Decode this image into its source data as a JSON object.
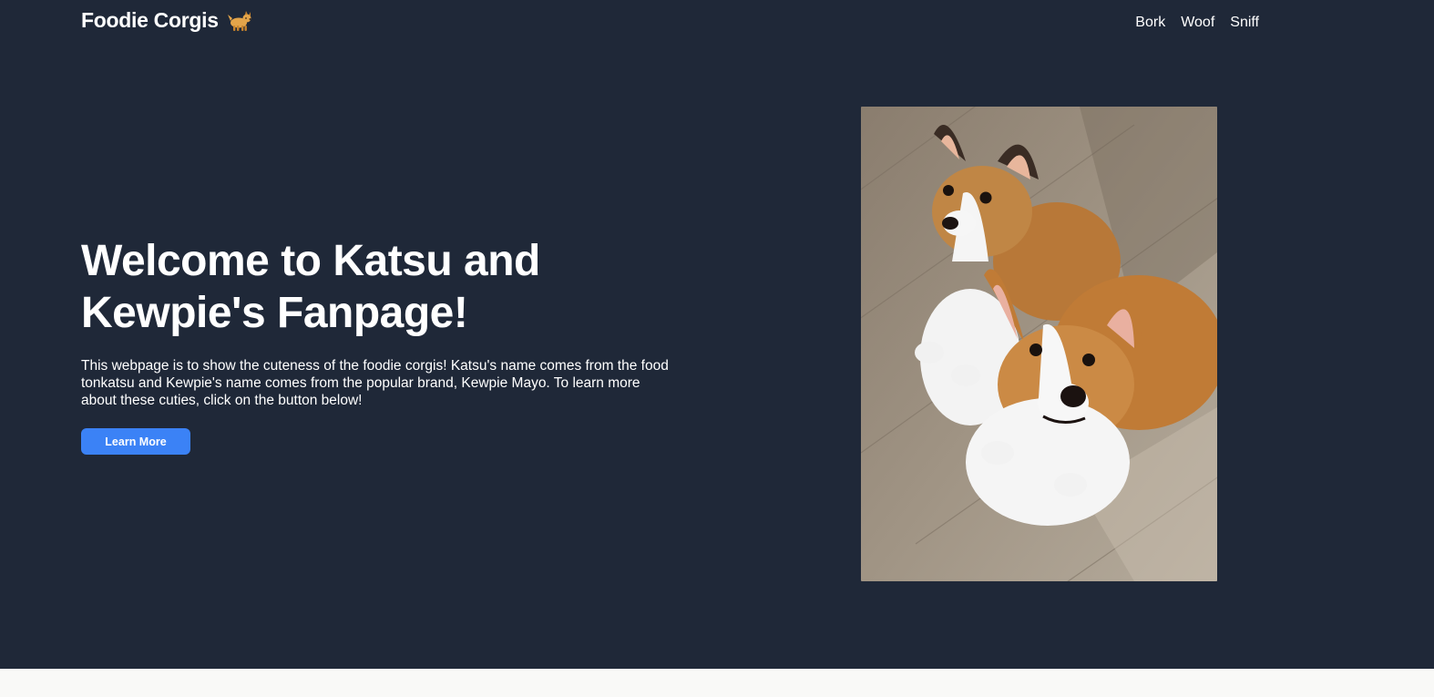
{
  "nav": {
    "brand": "Foodie Corgis",
    "brand_icon": "corgi-dog-icon",
    "links": [
      "Bork",
      "Woof",
      "Sniff"
    ]
  },
  "hero": {
    "title_line1": "Welcome to Katsu and",
    "title_line2": "Kewpie's Fanpage!",
    "description": "This webpage is to show the cuteness of the foodie corgis! Katsu's name comes from the food tonkatsu and Kewpie's name comes from the popular brand, Kewpie Mayo. To learn more about these cuties, click on the button below!",
    "button_label": "Learn More"
  },
  "colors": {
    "background": "#1f2838",
    "accent": "#3b82f6",
    "footer": "#f9f9f7"
  }
}
